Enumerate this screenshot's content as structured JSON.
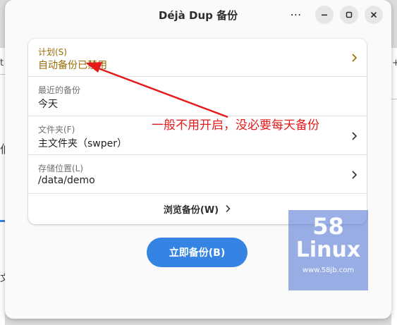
{
  "window": {
    "title": "Déjà Dup 备份",
    "menu_icon": "menu-dots-icon",
    "minimize_icon": "minimize-icon",
    "maximize_icon": "maximize-icon",
    "close_icon": "close-icon"
  },
  "settings": {
    "schedule": {
      "title": "计划(S)",
      "value": "自动备份已禁用"
    },
    "last_backup": {
      "title": "最近的备份",
      "value": "今天"
    },
    "folders": {
      "title": "文件夹(F)",
      "value": "主文件夹（swper）"
    },
    "location": {
      "title": "存储位置(L)",
      "value": "/data/demo"
    },
    "browse_label": "浏览备份(W)"
  },
  "backup_button": {
    "label": "立即备份(B)"
  },
  "annotation": {
    "text": "一般不用开启，没必要每天备份",
    "color": "#e31b1b"
  },
  "watermark": {
    "number": "58",
    "name": "Linux",
    "url": "www.58jb.com"
  },
  "background_app": {
    "fragments": [
      "t",
      "+",
      "伯",
      "文"
    ]
  },
  "colors": {
    "accent": "#3584e4",
    "warning": "#9b6a05",
    "annotation": "#e31b1b"
  }
}
